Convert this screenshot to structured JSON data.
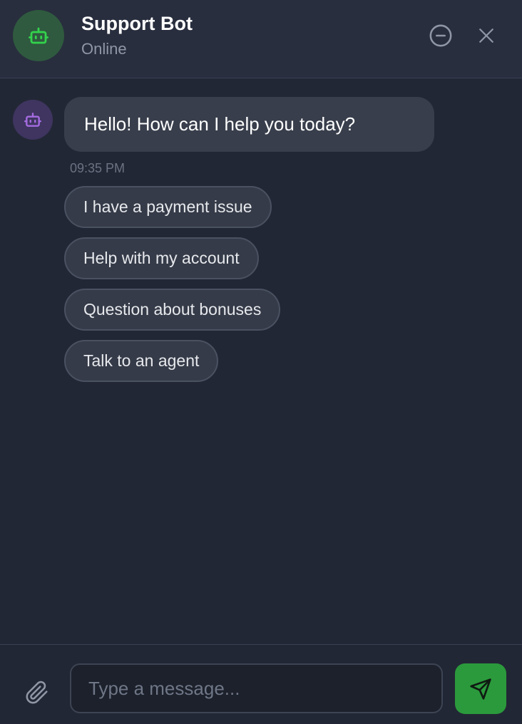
{
  "header": {
    "title": "Support Bot",
    "status": "Online"
  },
  "messages": [
    {
      "sender": "bot",
      "text": "Hello! How can I help you today?",
      "time": "09:35 PM"
    }
  ],
  "quick_replies": [
    "I have a payment issue",
    "Help with my account",
    "Question about bonuses",
    "Talk to an agent"
  ],
  "composer": {
    "placeholder": "Type a message..."
  },
  "icons": {
    "header_avatar": "bot-icon",
    "message_avatar": "bot-icon",
    "minimize": "minus-circle-icon",
    "close": "close-icon",
    "attach": "paperclip-icon",
    "send": "send-icon"
  },
  "colors": {
    "accent_green": "#2b9a3c",
    "bot_green": "#33d34c",
    "bot_purple": "#a56be0",
    "background": "#222735"
  }
}
